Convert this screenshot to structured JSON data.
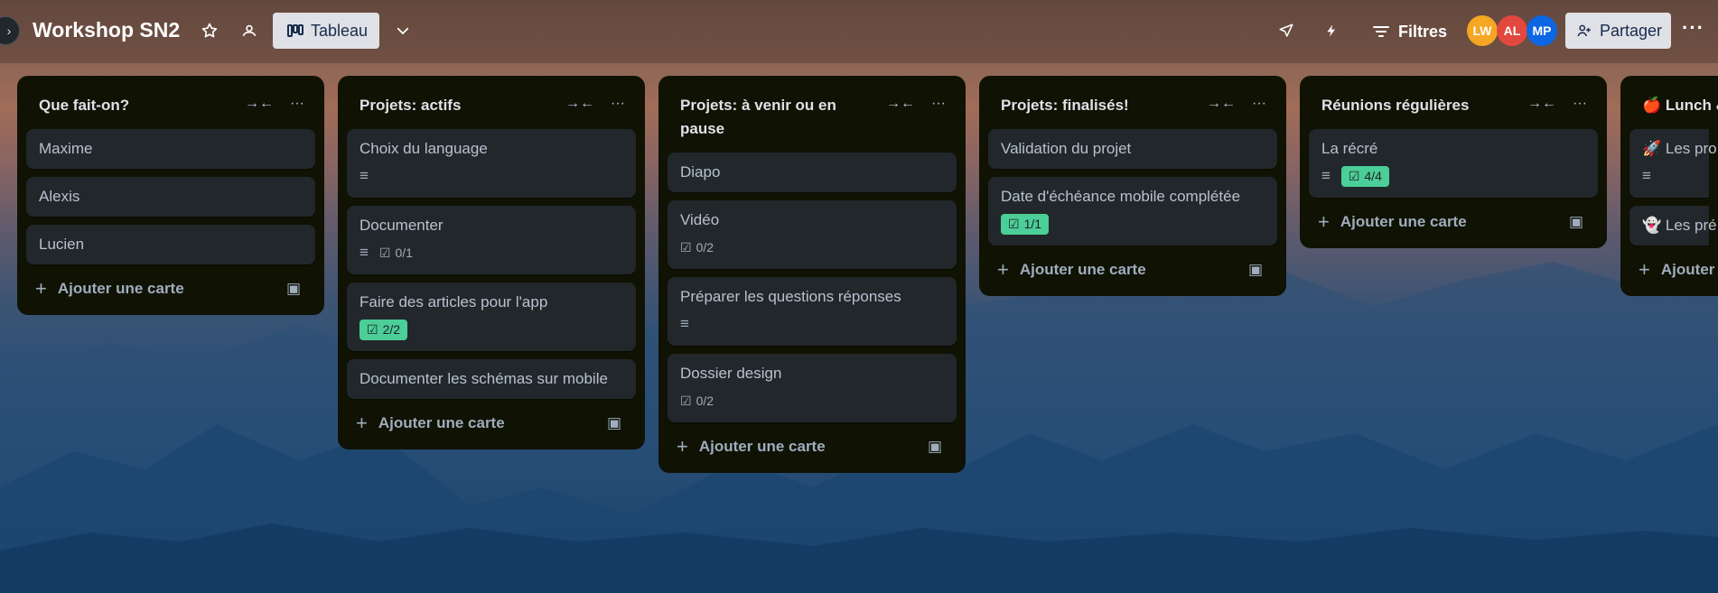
{
  "header": {
    "board_title": "Workshop SN2",
    "view_label": "Tableau",
    "filters_label": "Filtres",
    "share_label": "Partager",
    "members": [
      {
        "initials": "LW",
        "color": "#f5a623"
      },
      {
        "initials": "AL",
        "color": "#e2483d"
      },
      {
        "initials": "MP",
        "color": "#0c66e4"
      }
    ]
  },
  "icons": {
    "star": "star-icon",
    "visibility": "team-visibility-icon",
    "board": "board-view-icon",
    "chevron": "chevron-down-icon",
    "power_ups": "rocket-icon",
    "automation": "lightning-icon",
    "filter": "filter-icon",
    "share": "add-member-icon",
    "collapse": "collapse-list-icon",
    "more": "more-options-icon",
    "description": "description-icon",
    "checklist": "checklist-icon",
    "template": "card-template-icon"
  },
  "add_card_label": "Ajouter une carte",
  "lists": [
    {
      "title": "Que fait-on?",
      "cards": [
        {
          "title": "Maxime"
        },
        {
          "title": "Alexis"
        },
        {
          "title": "Lucien"
        }
      ]
    },
    {
      "title": "Projets: actifs",
      "cards": [
        {
          "title": "Choix du language",
          "description": true
        },
        {
          "title": "Documenter",
          "description": true,
          "checklist": "0/1"
        },
        {
          "title": "Faire des articles pour l'app",
          "checklist": "2/2",
          "complete": true
        },
        {
          "title": "Documenter les schémas sur mobile"
        }
      ]
    },
    {
      "title": "Projets: à venir ou en pause",
      "cards": [
        {
          "title": "Diapo"
        },
        {
          "title": "Vidéo",
          "checklist": "0/2"
        },
        {
          "title": "Préparer les questions réponses",
          "description": true
        },
        {
          "title": "Dossier design",
          "checklist": "0/2"
        }
      ]
    },
    {
      "title": "Projets: finalisés!",
      "cards": [
        {
          "title": "Validation du projet"
        },
        {
          "title": "Date d'échéance mobile complétée",
          "checklist": "1/1",
          "complete": true
        }
      ]
    },
    {
      "title": "Réunions régulières",
      "cards": [
        {
          "title": "La récré",
          "description": true,
          "checklist": "4/4",
          "complete": true
        }
      ]
    },
    {
      "title": "🍎 Lunch &",
      "cards": [
        {
          "title": "🚀 Les pro",
          "description": true
        },
        {
          "title": "👻 Les pré"
        }
      ]
    }
  ]
}
